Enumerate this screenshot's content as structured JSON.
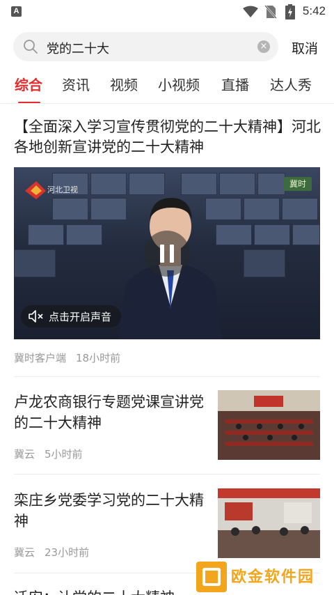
{
  "status_bar": {
    "time": "5:42",
    "notification_icon": "a-app-icon",
    "icons": [
      "wifi-icon",
      "no-sim-icon",
      "battery-icon"
    ]
  },
  "search": {
    "query": "党的二十大",
    "cancel_label": "取消",
    "icons": [
      "search-icon",
      "clear-icon"
    ]
  },
  "tabs": [
    {
      "label": "综合",
      "active": true
    },
    {
      "label": "资讯",
      "active": false
    },
    {
      "label": "视频",
      "active": false
    },
    {
      "label": "小视频",
      "active": false
    },
    {
      "label": "直播",
      "active": false
    },
    {
      "label": "达人秀",
      "active": false
    }
  ],
  "feed": {
    "video_article": {
      "title": "【全面深入学习宣传贯彻党的二十大精神】河北各地创新宣讲党的二十大精神",
      "channel_logo_text": "河北卫视",
      "corner_logo_text": "冀时",
      "sound_toggle_label": "点击开启声音",
      "source": "冀时客户端",
      "time": "18小时前"
    },
    "articles": [
      {
        "title": "卢龙农商银行专题党课宣讲党的二十大精神",
        "source": "冀云",
        "time": "5小时前"
      },
      {
        "title": "栾庄乡党委学习党的二十大精神",
        "source": "冀云",
        "time": "23小时前"
      },
      {
        "title": "迁安：让党的二十大精神",
        "source": "",
        "time": ""
      }
    ]
  },
  "watermark": {
    "name": "欧金软件园"
  },
  "colors": {
    "accent": "#e22b2b",
    "meta_text": "#999999",
    "search_bg": "#f2f2f2",
    "watermark": "#f3a51c"
  }
}
